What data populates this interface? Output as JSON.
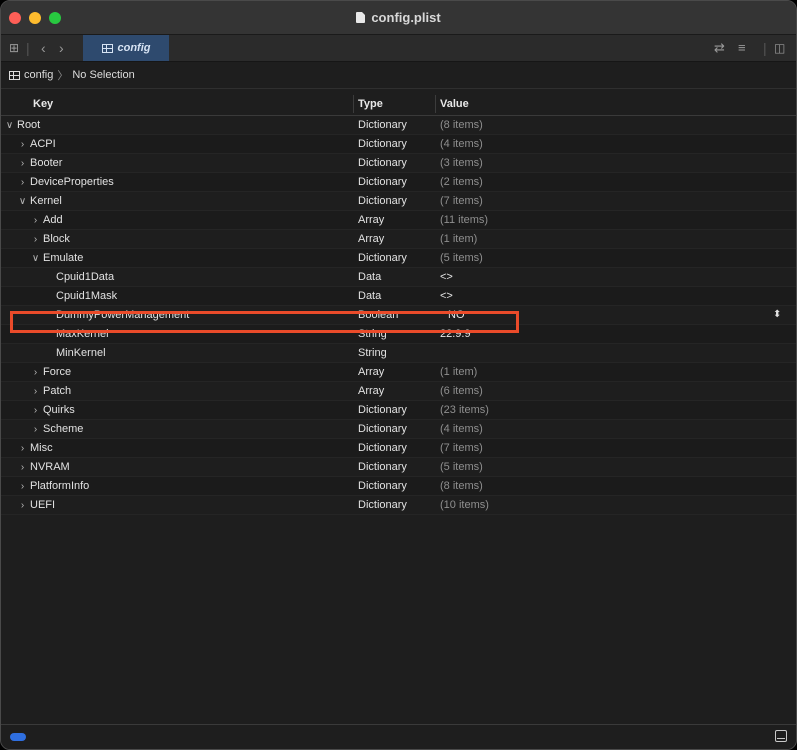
{
  "window": {
    "title": "config.plist"
  },
  "toolbar": {
    "tab_label": "config"
  },
  "pathbar": {
    "root": "config",
    "selection": "No Selection"
  },
  "header": {
    "key": "Key",
    "type": "Type",
    "value": "Value"
  },
  "rows": [
    {
      "key": "Root",
      "type": "Dictionary",
      "value": "(8 items)",
      "level": 0,
      "disclosure": "expanded"
    },
    {
      "key": "ACPI",
      "type": "Dictionary",
      "value": "(4 items)",
      "level": 1,
      "disclosure": "collapsed"
    },
    {
      "key": "Booter",
      "type": "Dictionary",
      "value": "(3 items)",
      "level": 1,
      "disclosure": "collapsed"
    },
    {
      "key": "DeviceProperties",
      "type": "Dictionary",
      "value": "(2 items)",
      "level": 1,
      "disclosure": "collapsed"
    },
    {
      "key": "Kernel",
      "type": "Dictionary",
      "value": "(7 items)",
      "level": 1,
      "disclosure": "expanded"
    },
    {
      "key": "Add",
      "type": "Array",
      "value": "(11 items)",
      "level": 2,
      "disclosure": "collapsed"
    },
    {
      "key": "Block",
      "type": "Array",
      "value": "(1 item)",
      "level": 2,
      "disclosure": "collapsed"
    },
    {
      "key": "Emulate",
      "type": "Dictionary",
      "value": "(5 items)",
      "level": 2,
      "disclosure": "expanded"
    },
    {
      "key": "Cpuid1Data",
      "type": "Data",
      "value": "<>",
      "level": 3,
      "disclosure": "none"
    },
    {
      "key": "Cpuid1Mask",
      "type": "Data",
      "value": "<>",
      "level": 3,
      "disclosure": "none"
    },
    {
      "key": "DummyPowerManagement",
      "type": "Boolean",
      "value": "NO",
      "level": 3,
      "disclosure": "none",
      "stepper": true
    },
    {
      "key": "MaxKernel",
      "type": "String",
      "value": "22.9.9",
      "level": 3,
      "disclosure": "none"
    },
    {
      "key": "MinKernel",
      "type": "String",
      "value": "",
      "level": 3,
      "disclosure": "none"
    },
    {
      "key": "Force",
      "type": "Array",
      "value": "(1 item)",
      "level": 2,
      "disclosure": "collapsed"
    },
    {
      "key": "Patch",
      "type": "Array",
      "value": "(6 items)",
      "level": 2,
      "disclosure": "collapsed"
    },
    {
      "key": "Quirks",
      "type": "Dictionary",
      "value": "(23 items)",
      "level": 2,
      "disclosure": "collapsed"
    },
    {
      "key": "Scheme",
      "type": "Dictionary",
      "value": "(4 items)",
      "level": 2,
      "disclosure": "collapsed"
    },
    {
      "key": "Misc",
      "type": "Dictionary",
      "value": "(7 items)",
      "level": 1,
      "disclosure": "collapsed"
    },
    {
      "key": "NVRAM",
      "type": "Dictionary",
      "value": "(5 items)",
      "level": 1,
      "disclosure": "collapsed"
    },
    {
      "key": "PlatformInfo",
      "type": "Dictionary",
      "value": "(8 items)",
      "level": 1,
      "disclosure": "collapsed"
    },
    {
      "key": "UEFI",
      "type": "Dictionary",
      "value": "(10 items)",
      "level": 1,
      "disclosure": "collapsed"
    }
  ],
  "colors": {
    "highlight": "#ea4b2a",
    "tab_bg": "#2e4a6e",
    "accent": "#2f6fe0"
  },
  "icons": [
    "grid-icon",
    "chevron-left-icon",
    "chevron-right-icon",
    "swap-icon",
    "list-icon",
    "sidebar-icon",
    "document-icon",
    "stepper-icon"
  ]
}
